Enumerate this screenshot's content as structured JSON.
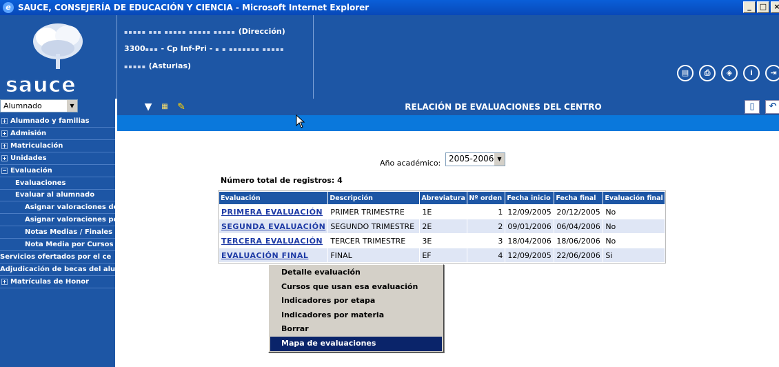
{
  "window": {
    "title": "SAUCE, CONSEJERÍA DE EDUCACIÓN Y CIENCIA - Microsoft Internet Explorer",
    "buttons": [
      "_",
      "□",
      "×"
    ]
  },
  "header": {
    "logo_text": "sauce",
    "school": {
      "line1_suffix": "(Dirección)",
      "line2_prefix": "3300",
      "line2_mid": "- Cp Inf-Pri -",
      "line3_suffix": "(Asturias)"
    },
    "icons": [
      "page-icon",
      "print-icon",
      "navigate-icon",
      "info-icon",
      "exit-icon"
    ]
  },
  "sidebar": {
    "profile_select": "Alumnado",
    "items": [
      {
        "label": "Alumnado y familias",
        "type": "plus"
      },
      {
        "label": "Admisión",
        "type": "plus"
      },
      {
        "label": "Matriculación",
        "type": "plus"
      },
      {
        "label": "Unidades",
        "type": "plus"
      },
      {
        "label": "Evaluación",
        "type": "minus"
      },
      {
        "label": "Evaluaciones",
        "type": "sub"
      },
      {
        "label": "Evaluar al alumnado",
        "type": "sub"
      },
      {
        "label": "Asignar valoraciones de",
        "type": "sub2"
      },
      {
        "label": "Asignar valoraciones por",
        "type": "sub2"
      },
      {
        "label": "Notas Medias / Finales",
        "type": "sub2"
      },
      {
        "label": "Nota Media por Cursos",
        "type": "sub2"
      },
      {
        "label": "Servicios ofertados por el ce",
        "type": "flat"
      },
      {
        "label": "Adjudicación de becas del alu",
        "type": "flat"
      },
      {
        "label": "Matrículas de Honor",
        "type": "plus"
      }
    ]
  },
  "toolbar": {
    "page_title": "RELACIÓN DE EVALUACIONES DEL CENTRO"
  },
  "content": {
    "year_label": "Año académico:",
    "year_value": "2005-2006",
    "total_records": "Número total de registros: 4",
    "columns": [
      "Evaluación",
      "Descripción",
      "Abreviatura",
      "Nº orden",
      "Fecha inicio",
      "Fecha final",
      "Evaluación final"
    ],
    "rows": [
      [
        "PRIMERA EVALUACIÓN",
        "PRIMER TRIMESTRE",
        "1E",
        "1",
        "12/09/2005",
        "20/12/2005",
        "No"
      ],
      [
        "SEGUNDA EVALUACIÓN",
        "SEGUNDO TRIMESTRE",
        "2E",
        "2",
        "09/01/2006",
        "06/04/2006",
        "No"
      ],
      [
        "TERCERA EVALUACIÓN",
        "TERCER TRIMESTRE",
        "3E",
        "3",
        "18/04/2006",
        "18/06/2006",
        "No"
      ],
      [
        "EVALUACIÓN FINAL",
        "FINAL",
        "EF",
        "4",
        "12/09/2005",
        "22/06/2006",
        "Si"
      ]
    ]
  },
  "context_menu": {
    "items": [
      "Detalle evaluación",
      "Cursos que usan esa evaluación",
      "Indicadores por etapa",
      "Indicadores por materia",
      "Borrar",
      "Mapa de evaluaciones"
    ],
    "selected_index": 5
  }
}
